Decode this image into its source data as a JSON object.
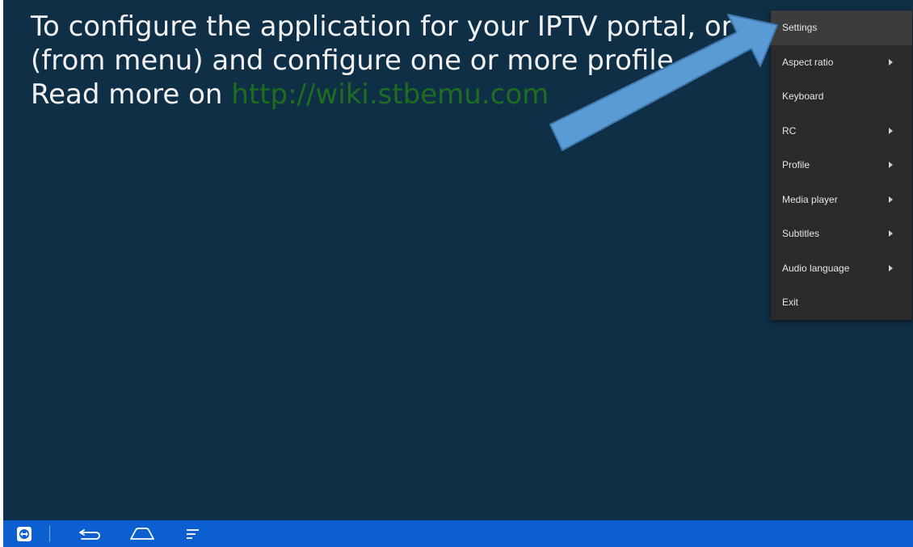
{
  "info": {
    "line1": "To configure the application for your IPTV portal, or",
    "line2": "(from menu) and configure one or more profile",
    "line3_prefix": "Read more on ",
    "link": "http://wiki.stbemu.com"
  },
  "menu": {
    "items": [
      {
        "label": "Settings",
        "has_submenu": false,
        "highlighted": true
      },
      {
        "label": "Aspect ratio",
        "has_submenu": true
      },
      {
        "label": "Keyboard",
        "has_submenu": false
      },
      {
        "label": "RC",
        "has_submenu": true
      },
      {
        "label": "Profile",
        "has_submenu": true
      },
      {
        "label": "Media player",
        "has_submenu": true
      },
      {
        "label": "Subtitles",
        "has_submenu": true
      },
      {
        "label": "Audio language",
        "has_submenu": true
      },
      {
        "label": "Exit",
        "has_submenu": false
      }
    ]
  },
  "navbar": {
    "icons": [
      "teamviewer-icon",
      "back-icon",
      "home-icon",
      "recent-apps-icon"
    ]
  },
  "colors": {
    "background": "#0f2f47",
    "menu_background": "#2a2a2a",
    "link": "#1f6e1f",
    "annotation_arrow": "#5b9bd5",
    "navbar": "#0c5fd0"
  }
}
